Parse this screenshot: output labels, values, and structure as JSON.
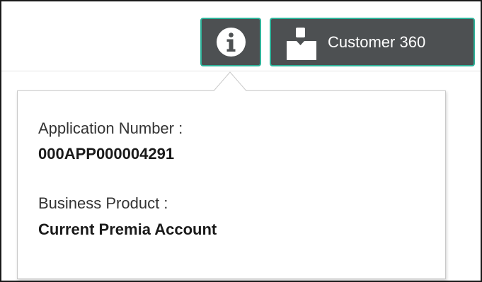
{
  "toolbar": {
    "info_button_icon": "info-icon",
    "customer_button": {
      "icon": "person-icon",
      "label": "Customer 360"
    },
    "accent_color": "#2fb39a",
    "button_color": "#4d5052"
  },
  "popover": {
    "fields": [
      {
        "label": "Application Number :",
        "value": "000APP000004291"
      },
      {
        "label": "Business Product :",
        "value": "Current Premia Account"
      }
    ]
  }
}
